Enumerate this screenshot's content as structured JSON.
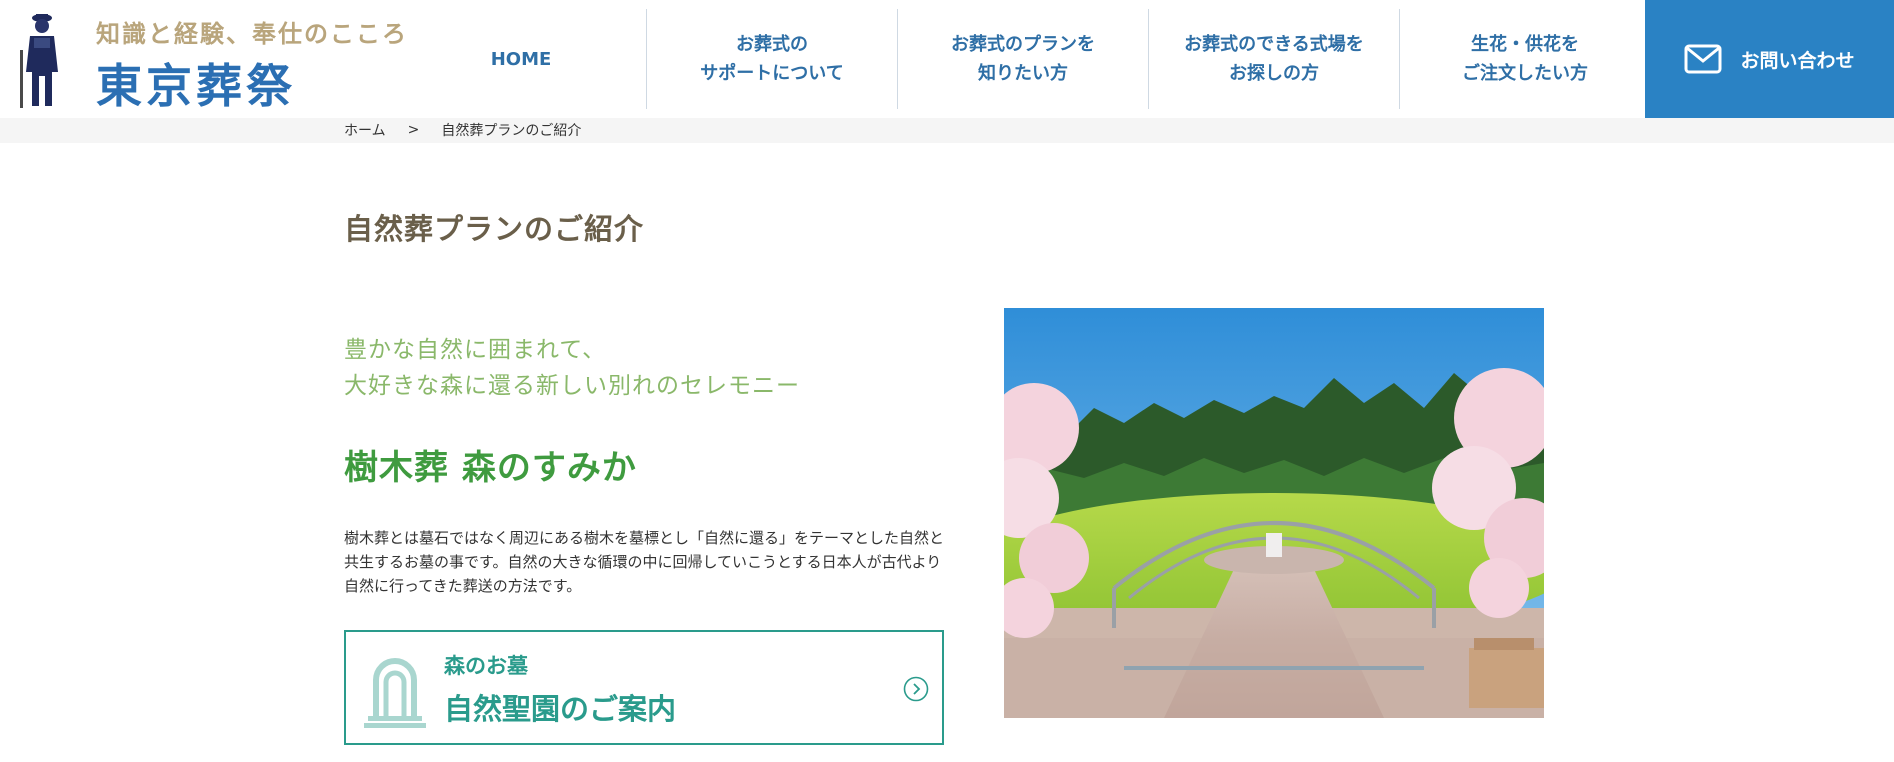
{
  "header": {
    "tagline": "知識と経験、奉仕のこころ",
    "brand": "東京葬祭",
    "nav": [
      {
        "label": "HOME"
      },
      {
        "label": "お葬式の\nサポートについて"
      },
      {
        "label": "お葬式のプランを\n知りたい方"
      },
      {
        "label": "お葬式のできる式場を\nお探しの方"
      },
      {
        "label": "生花・供花を\nご注文したい方"
      }
    ],
    "contact_label": "お問い合わせ",
    "contact_icon": "mail-icon"
  },
  "breadcrumb": {
    "home": "ホーム",
    "separator": ">",
    "current": "自然葬プランのご紹介"
  },
  "main": {
    "page_title": "自然葬プランのご紹介",
    "lead_line1": "豊かな自然に囲まれて、",
    "lead_line2": "大好きな森に還る新しい別れのセレモニー",
    "plan_name": "樹木葬 森のすみか",
    "description": "樹木葬とは墓石ではなく周辺にある樹木を墓標とし「自然に還る」をテーマとした自然と共生するお墓の事です。自然の大きな循環の中に回帰していこうとする日本人が古代より自然に行ってきた葬送の方法です。",
    "guide_card": {
      "sub": "森のお墓",
      "main": "自然聖園のご案内",
      "icon": "grave-icon",
      "arrow_icon": "chevron-right-circle-icon"
    },
    "photo_icon": "tree-burial-garden-photo"
  },
  "colors": {
    "brand_blue": "#2b6fb3",
    "nav_text": "#2f6fa6",
    "contact_bg": "#2a82c4",
    "tagline_gold": "#b9a57c",
    "lead_green": "#8ab86a",
    "plan_green": "#3f9b3f",
    "card_teal": "#2a9b8c"
  }
}
